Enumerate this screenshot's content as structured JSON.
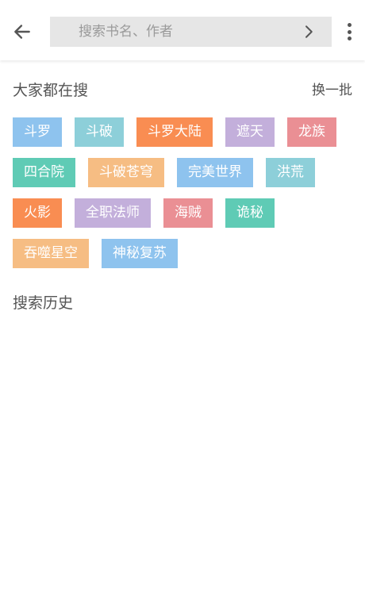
{
  "header": {
    "back_icon": "arrow-left-icon",
    "search_placeholder": "搜索书名、作者",
    "search_value": "",
    "go_icon": "chevron-right-icon",
    "more_icon": "more-vertical-icon"
  },
  "hot": {
    "title": "大家都在搜",
    "refresh_label": "换一批",
    "tags": [
      {
        "label": "斗罗",
        "color": "#8ec3ee"
      },
      {
        "label": "斗破",
        "color": "#8dcfd9"
      },
      {
        "label": "斗罗大陆",
        "color": "#f98d52"
      },
      {
        "label": "遮天",
        "color": "#c3afdb"
      },
      {
        "label": "龙族",
        "color": "#ea8f94"
      },
      {
        "label": "四合院",
        "color": "#5fcbb5"
      },
      {
        "label": "斗破苍穹",
        "color": "#f6bd83"
      },
      {
        "label": "完美世界",
        "color": "#8ec3ee"
      },
      {
        "label": "洪荒",
        "color": "#8dcfd9"
      },
      {
        "label": "火影",
        "color": "#f98d52"
      },
      {
        "label": "全职法师",
        "color": "#c3afdb"
      },
      {
        "label": "海贼",
        "color": "#ea8f94"
      },
      {
        "label": "诡秘",
        "color": "#5fcbb5"
      },
      {
        "label": "吞噬星空",
        "color": "#f6bd83"
      },
      {
        "label": "神秘复苏",
        "color": "#8ec3ee"
      }
    ]
  },
  "history": {
    "title": "搜索历史",
    "items": []
  }
}
